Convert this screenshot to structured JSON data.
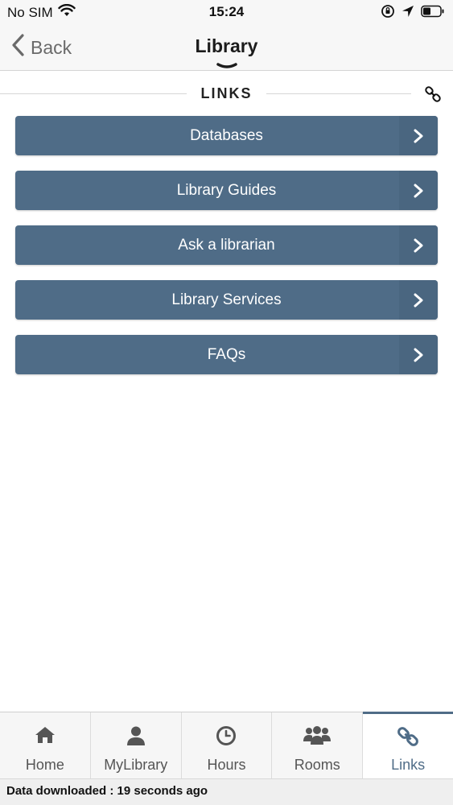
{
  "status_bar": {
    "carrier": "No SIM",
    "time": "15:24",
    "icons": [
      "wifi-icon",
      "orientation-lock-icon",
      "location-arrow-icon",
      "battery-icon"
    ]
  },
  "nav": {
    "back_label": "Back",
    "title": "Library"
  },
  "section": {
    "title": "LINKS",
    "icon": "link-icon"
  },
  "links": [
    {
      "label": "Databases"
    },
    {
      "label": "Library Guides"
    },
    {
      "label": "Ask a librarian"
    },
    {
      "label": "Library Services"
    },
    {
      "label": "FAQs"
    }
  ],
  "tabs": [
    {
      "label": "Home",
      "icon": "home-icon",
      "active": false
    },
    {
      "label": "MyLibrary",
      "icon": "user-icon",
      "active": false
    },
    {
      "label": "Hours",
      "icon": "clock-icon",
      "active": false
    },
    {
      "label": "Rooms",
      "icon": "group-icon",
      "active": false
    },
    {
      "label": "Links",
      "icon": "link-icon",
      "active": true
    }
  ],
  "footer": {
    "text": "Data downloaded : 19 seconds ago"
  },
  "colors": {
    "accent": "#4f6c87",
    "button_bg": "#4f6c87",
    "button_text": "#ffffff",
    "tab_inactive": "#555555"
  }
}
